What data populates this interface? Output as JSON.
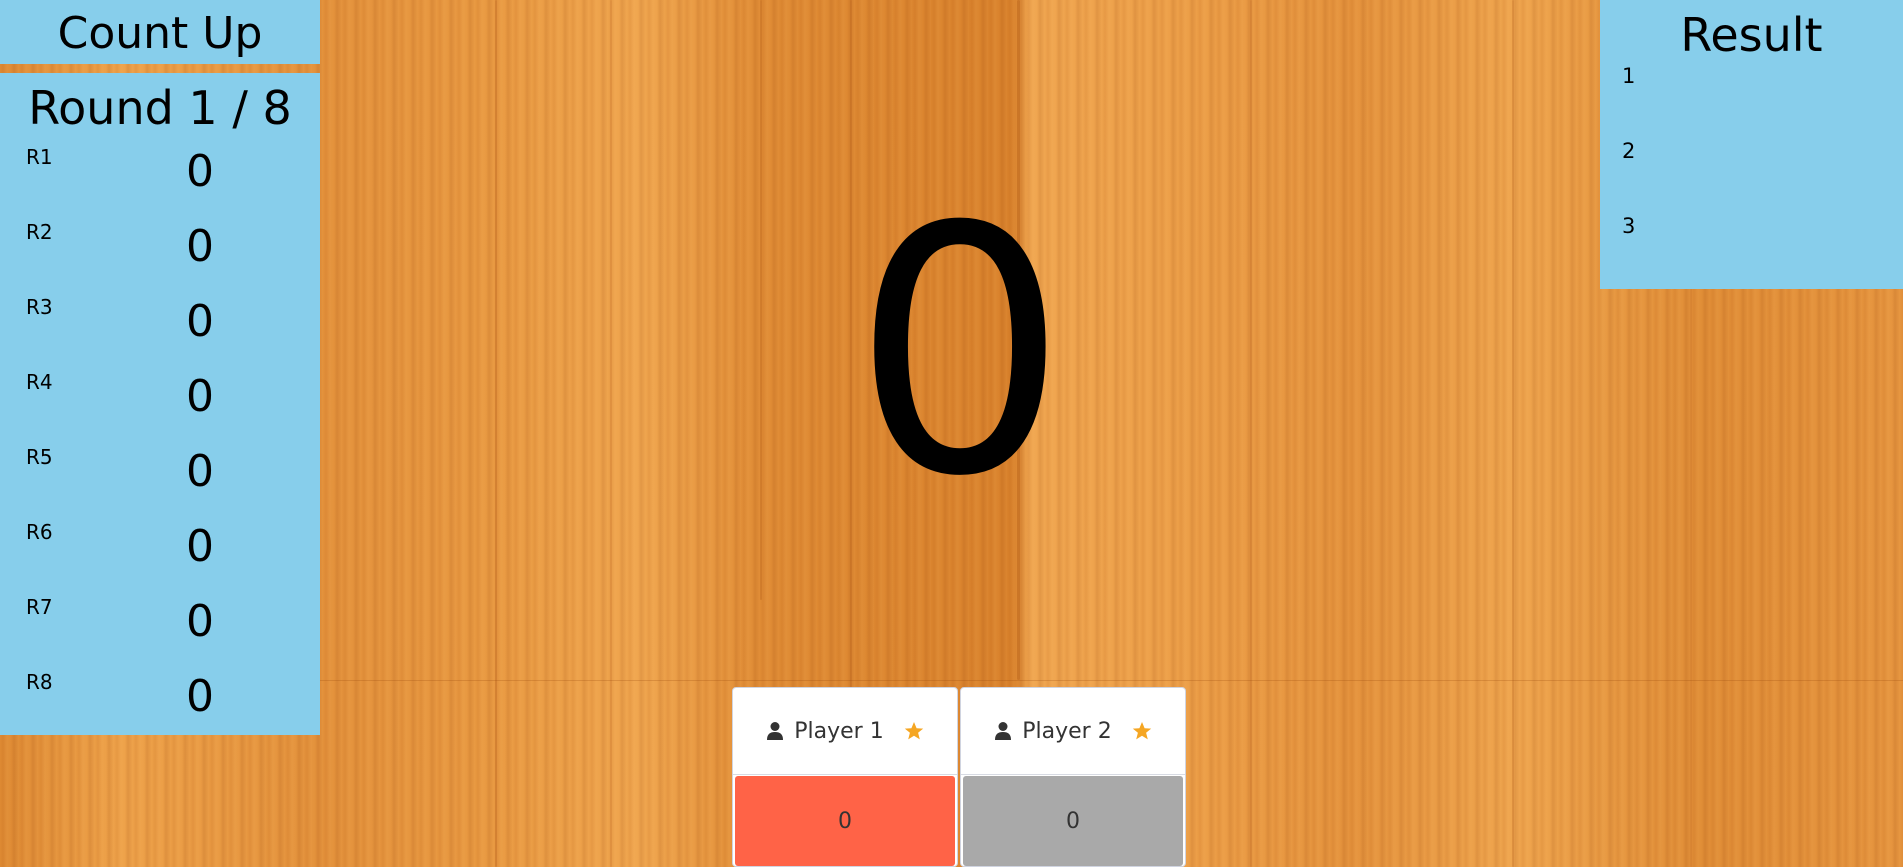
{
  "game": {
    "title": "Count Up"
  },
  "round_panel": {
    "header": "Round 1 / 8",
    "rounds": [
      {
        "label": "R1",
        "score": "0"
      },
      {
        "label": "R2",
        "score": "0"
      },
      {
        "label": "R3",
        "score": "0"
      },
      {
        "label": "R4",
        "score": "0"
      },
      {
        "label": "R5",
        "score": "0"
      },
      {
        "label": "R6",
        "score": "0"
      },
      {
        "label": "R7",
        "score": "0"
      },
      {
        "label": "R8",
        "score": "0"
      }
    ]
  },
  "current_score": "0",
  "result_panel": {
    "title": "Result",
    "ranks": [
      "1",
      "2",
      "3"
    ]
  },
  "players": [
    {
      "name": "Player 1",
      "score": "0",
      "icon": "user-icon",
      "badge_icon": "star-icon",
      "score_bg": "#ff6347",
      "active": true
    },
    {
      "name": "Player 2",
      "score": "0",
      "icon": "user-icon",
      "badge_icon": "star-icon",
      "score_bg": "#a9a9a9",
      "active": false
    }
  ],
  "colors": {
    "panel_bg": "#87ceeb",
    "star": "#f5a623",
    "active_player": "#ff6347",
    "inactive_player": "#a9a9a9"
  }
}
